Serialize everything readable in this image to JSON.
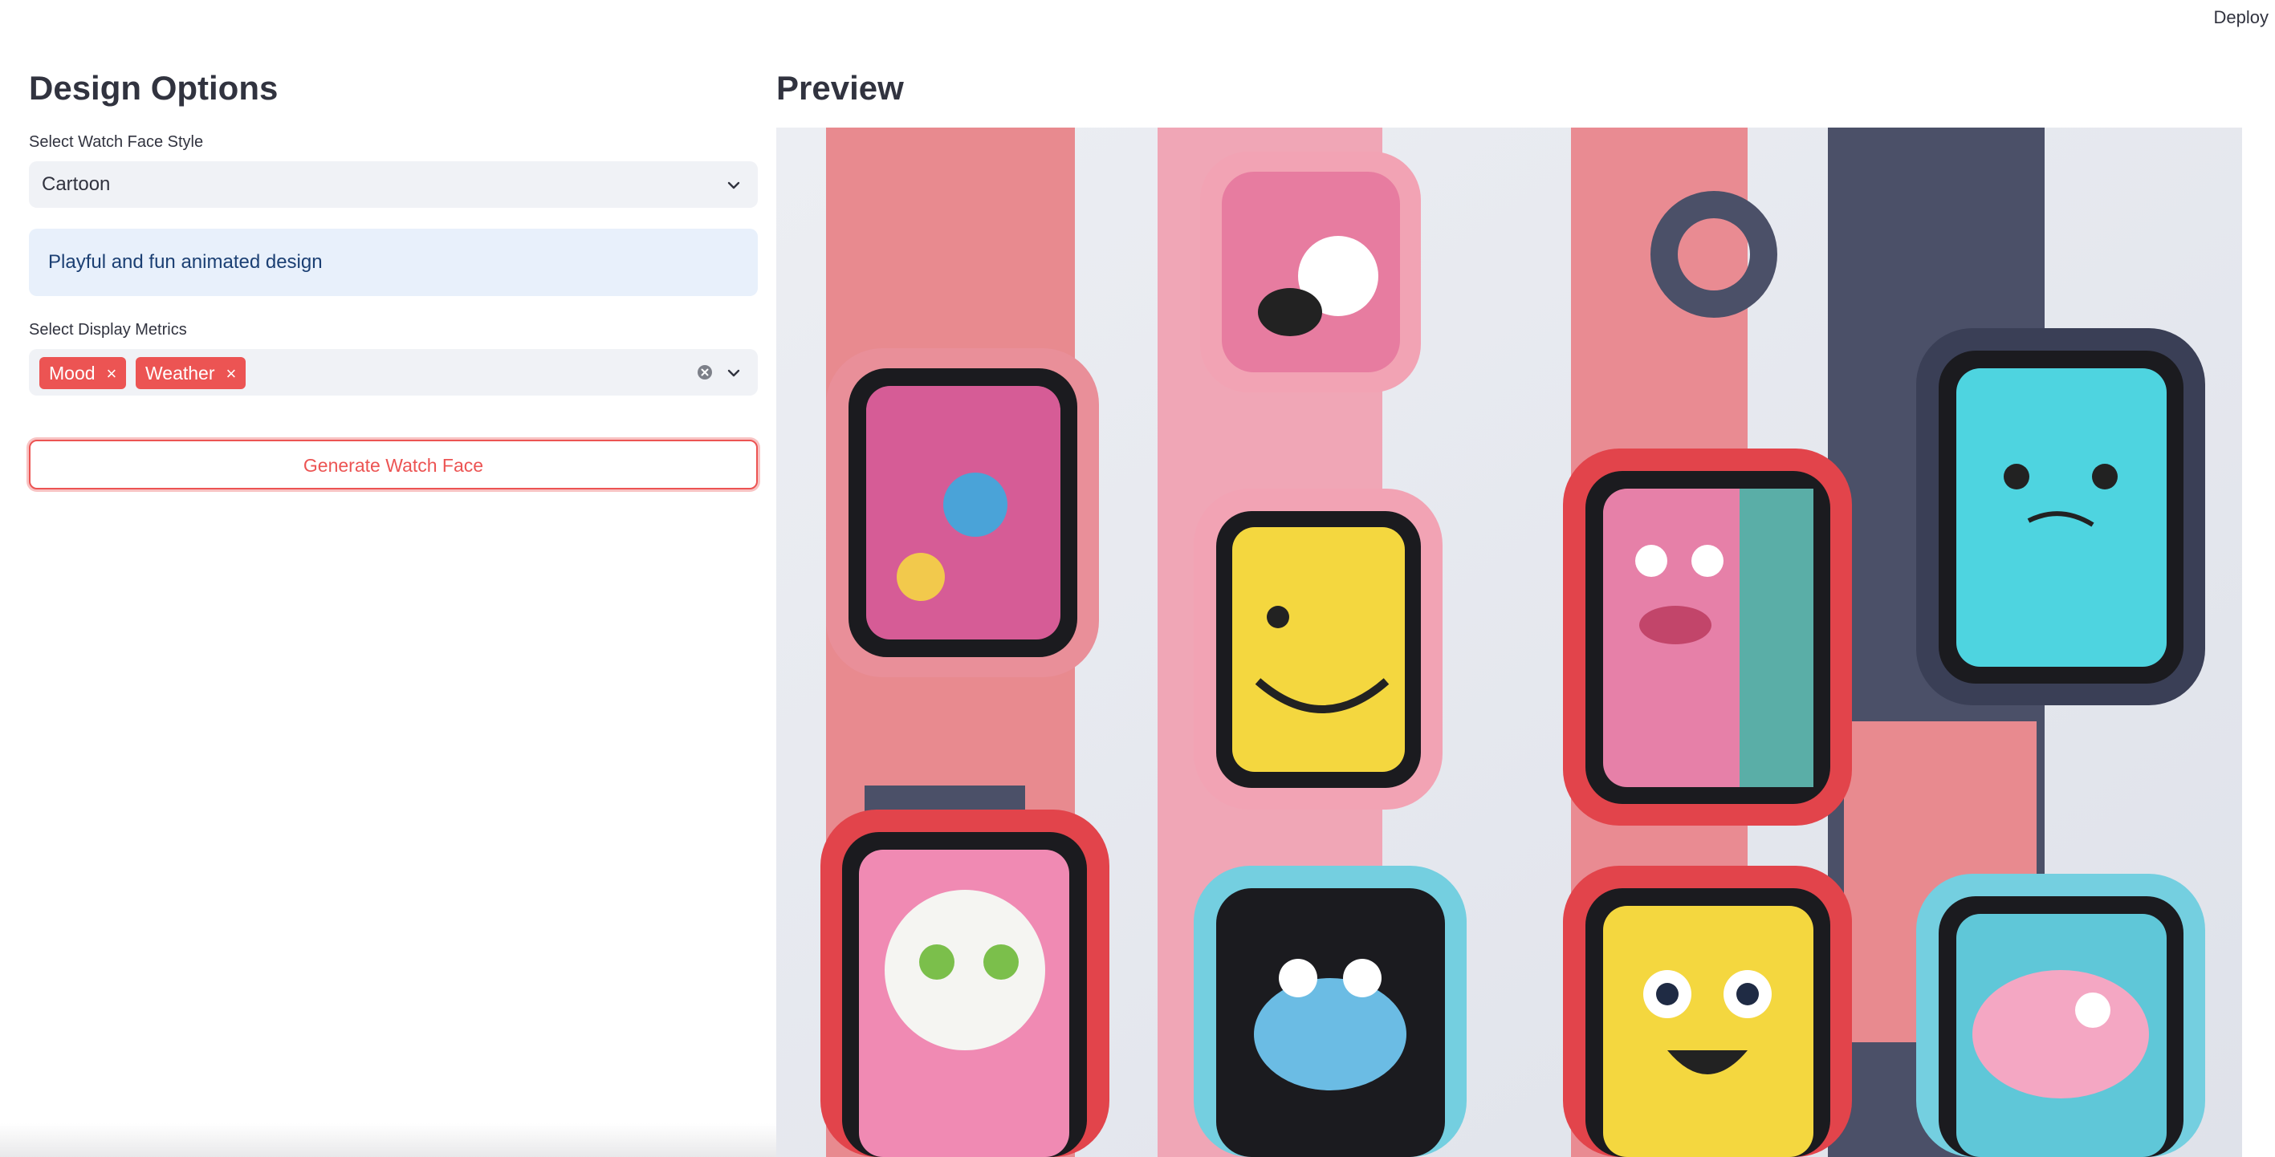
{
  "header": {
    "deploy_label": "Deploy"
  },
  "sidebar": {
    "title": "Design Options",
    "style_select": {
      "label": "Select Watch Face Style",
      "value": "Cartoon"
    },
    "info_text": "Playful and fun animated design",
    "metrics_select": {
      "label": "Select Display Metrics",
      "tags": [
        "Mood",
        "Weather"
      ],
      "tag_remove_glyph": "×"
    },
    "generate_button_label": "Generate Watch Face"
  },
  "preview": {
    "title": "Preview",
    "image_description": "Grid of colorful cartoon smartwatches with pink, red, navy and cyan straps and animated faces"
  },
  "colors": {
    "primary": "#ec5453",
    "text": "#31333f",
    "input_bg": "#f0f2f6",
    "info_bg": "#e8f0fb",
    "info_text": "#1b3f73"
  },
  "icons": {
    "chevron": "chevron-down-icon",
    "clear": "clear-all-icon",
    "tag_remove": "close-icon"
  }
}
